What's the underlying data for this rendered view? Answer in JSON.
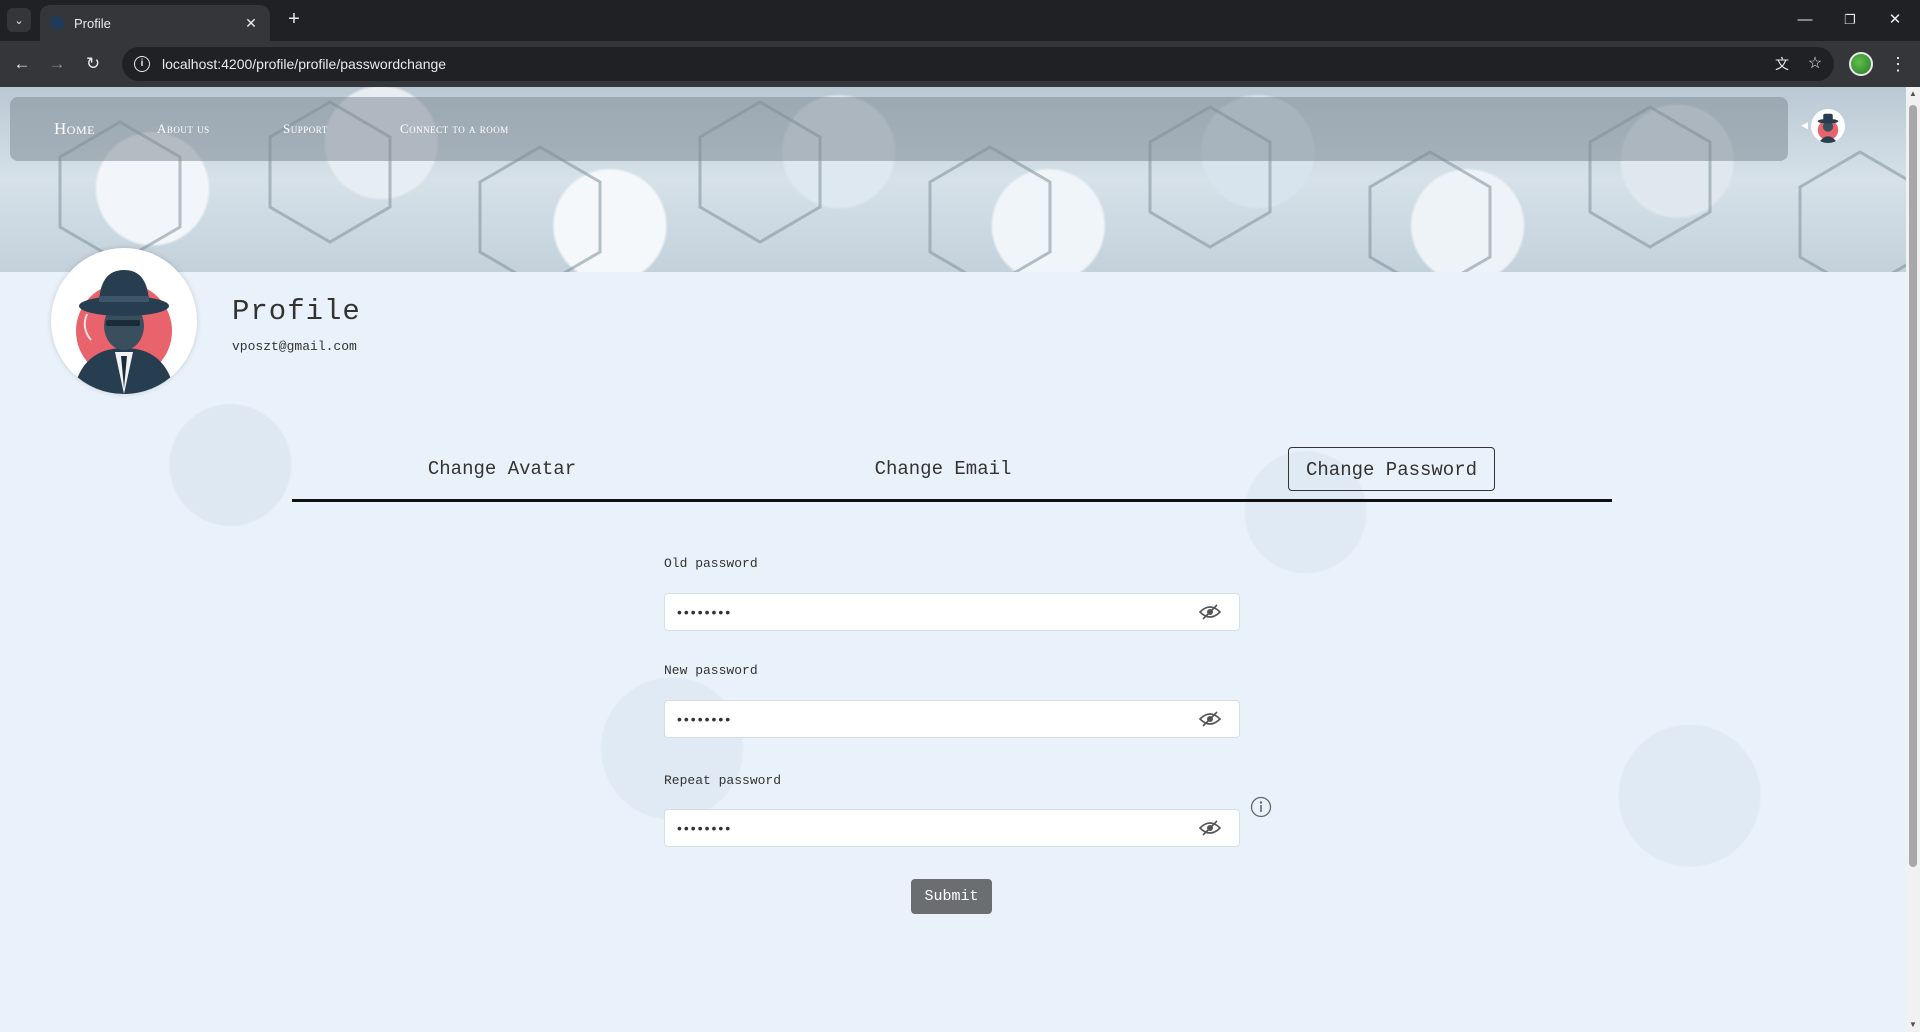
{
  "browser": {
    "tab_title": "Profile",
    "url": "localhost:4200/profile/profile/passwordchange",
    "tab_menu_icon": "chevron-down-icon",
    "new_tab_icon": "plus-icon"
  },
  "navbar": {
    "links": [
      {
        "label": "Home"
      },
      {
        "label": "About us"
      },
      {
        "label": "Support"
      },
      {
        "label": "Connect to a room"
      }
    ]
  },
  "profile": {
    "title": "Profile",
    "email": "vposzt@gmail.com"
  },
  "tabs": [
    {
      "label": "Change Avatar",
      "active": false
    },
    {
      "label": "Change Email",
      "active": false
    },
    {
      "label": "Change Password",
      "active": true
    }
  ],
  "form": {
    "old_password": {
      "label": "Old password",
      "value": "••••••••"
    },
    "new_password": {
      "label": "New password",
      "value": "••••••••"
    },
    "repeat_password": {
      "label": "Repeat password",
      "value": "••••••••"
    },
    "submit_label": "Submit"
  },
  "colors": {
    "chrome_bg": "#202124",
    "toolbar_bg": "#35363a",
    "page_bg": "#e9f2fa",
    "submit_bg": "#6b6e70",
    "avatar_accent": "#e8636b",
    "avatar_dark": "#263e4f"
  }
}
